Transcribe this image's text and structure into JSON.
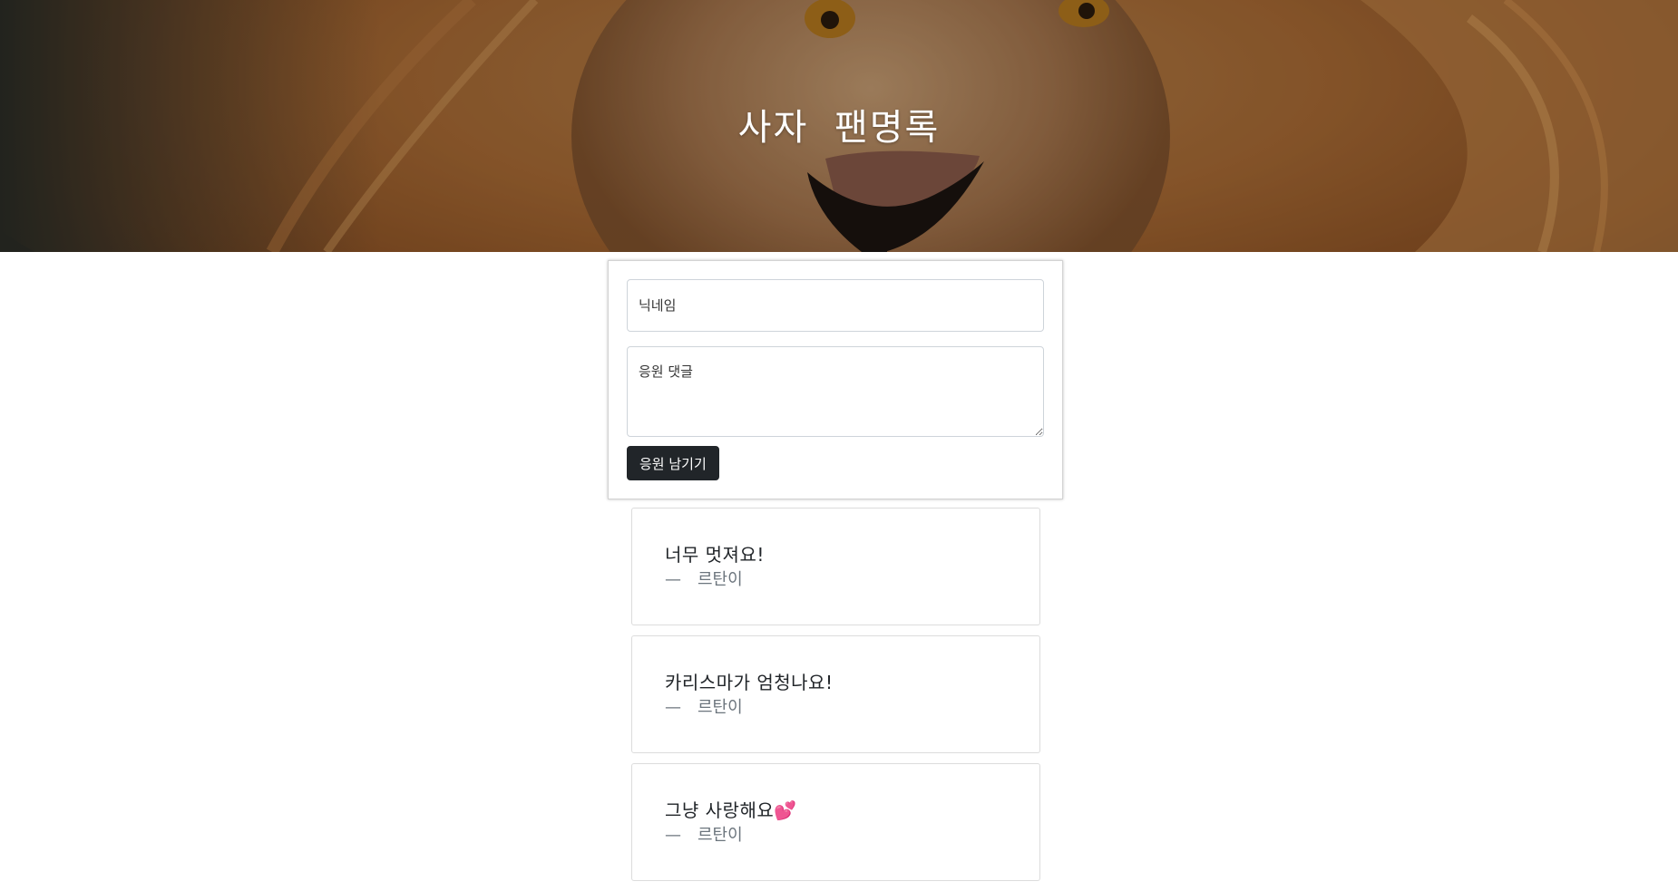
{
  "header": {
    "title": "사자 팬명록"
  },
  "form": {
    "nickname_placeholder": "닉네임",
    "comment_placeholder": "응원 댓글",
    "submit_label": "응원 남기기"
  },
  "comments": [
    {
      "text": "너무 멋져요!",
      "dash": "—",
      "author": "르탄이"
    },
    {
      "text": "카리스마가 엄청나요!",
      "dash": "—",
      "author": "르탄이"
    },
    {
      "text": "그냥 사랑해요💕",
      "dash": "—",
      "author": "르탄이"
    }
  ]
}
